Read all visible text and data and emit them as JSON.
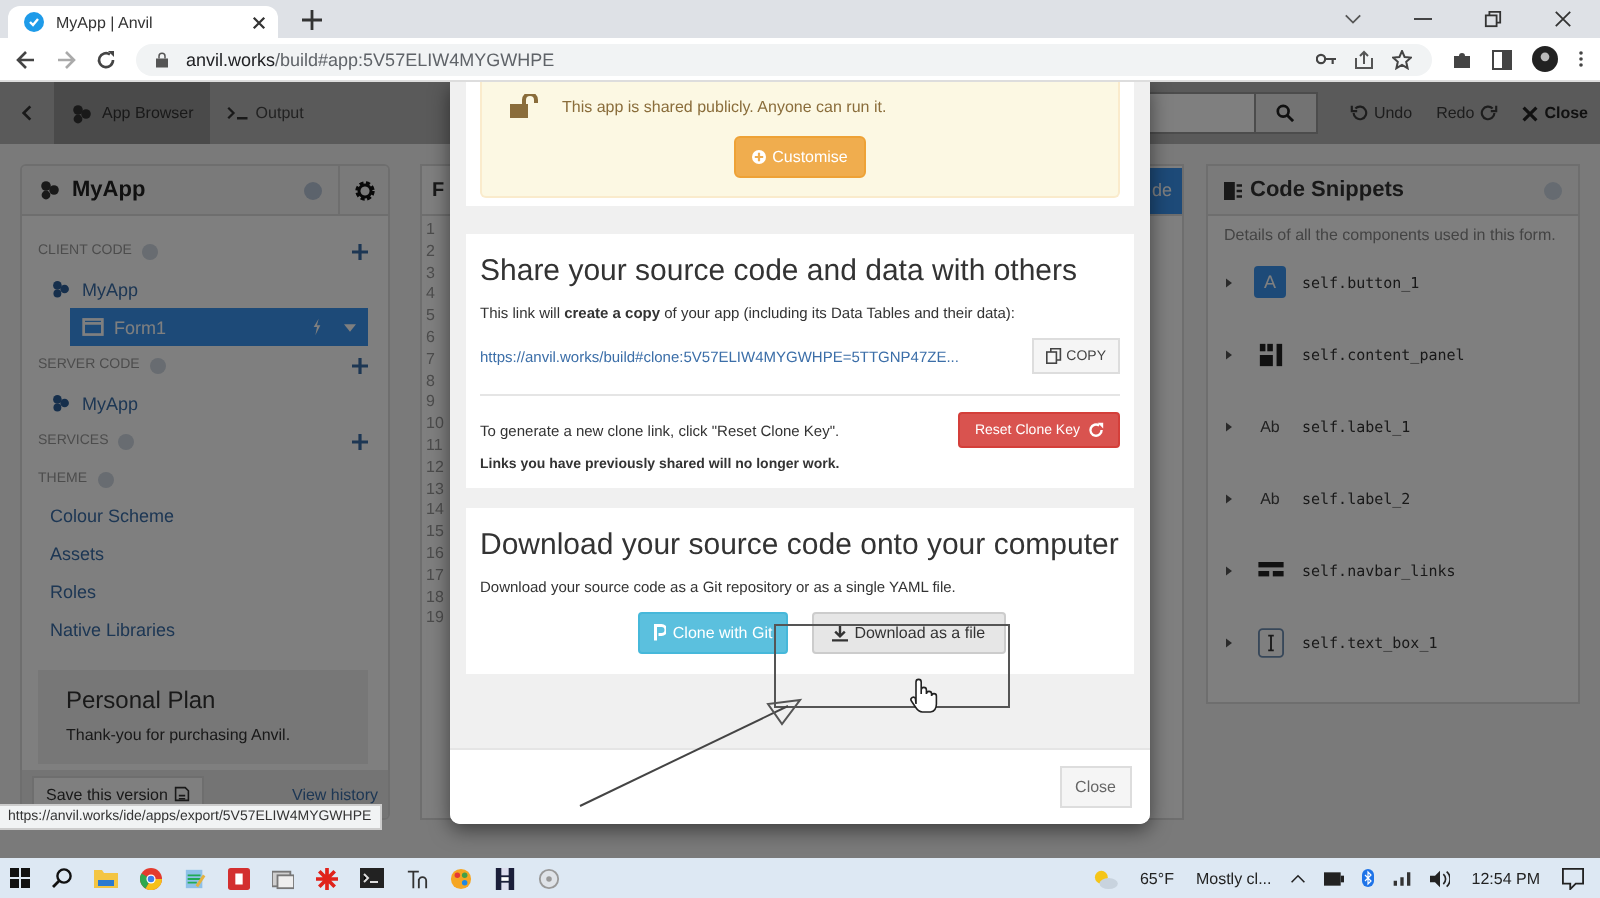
{
  "browser": {
    "tab_title": "MyApp | Anvil",
    "url_host": "anvil.works",
    "url_path": "/build#app:5V57ELIW4MYGWHPE"
  },
  "toolbar": {
    "app_browser": "App Browser",
    "output": "Output",
    "actions": [
      {
        "kind": "undo",
        "label": "Undo",
        "disabled": true
      },
      {
        "kind": "redo",
        "label": "Redo",
        "disabled": true
      },
      {
        "kind": "close",
        "label": "Close",
        "disabled": false
      }
    ]
  },
  "sidebar": {
    "app_name": "MyApp",
    "sections": [
      {
        "kind": "tree",
        "label": "CLIENT CODE",
        "add_button": true,
        "items": [
          {
            "kind": "package",
            "label": "MyApp",
            "selected": false,
            "children": [
              {
                "kind": "form",
                "label": "Form1",
                "selected": true
              }
            ]
          }
        ]
      },
      {
        "kind": "tree",
        "label": "SERVER CODE",
        "add_button": true,
        "items": [
          {
            "kind": "package",
            "label": "MyApp",
            "selected": false
          }
        ]
      },
      {
        "kind": "tree",
        "label": "SERVICES",
        "add_button": true
      },
      {
        "kind": "links",
        "label": "THEME",
        "add_button": false,
        "links": [
          "Colour Scheme",
          "Assets",
          "Roles",
          "Native Libraries"
        ]
      }
    ],
    "plan": {
      "title": "Personal Plan",
      "text": "Thank-you for purchasing Anvil."
    },
    "save_button": "Save this version",
    "history_link": "View history"
  },
  "editor": {
    "title": "F",
    "action": "de",
    "line_numbers": [
      "1",
      "2",
      "3",
      "4",
      "5",
      "6",
      "7",
      "8",
      "9",
      "10",
      "11",
      "12",
      "13",
      "14",
      "15",
      "16",
      "17",
      "18",
      "19"
    ]
  },
  "snippets": {
    "title": "Code Snippets",
    "description": "Details of all the components used in this form.",
    "items": [
      {
        "kind": "button",
        "badge": "A",
        "name": "self.button_1"
      },
      {
        "kind": "panel",
        "name": "self.content_panel"
      },
      {
        "kind": "label",
        "badge": "Ab",
        "name": "self.label_1"
      },
      {
        "kind": "label",
        "badge": "Ab",
        "name": "self.label_2"
      },
      {
        "kind": "navbar",
        "name": "self.navbar_links"
      },
      {
        "kind": "textbox",
        "name": "self.text_box_1"
      }
    ]
  },
  "modal": {
    "banner": {
      "text": "This app is shared publicly. Anyone can run it.",
      "button": "Customise"
    },
    "share": {
      "heading": "Share your source code and data with others",
      "text": "This link will **create a copy** of your app (including its Data Tables and their data):",
      "link": "https://anvil.works/build#clone:5V57ELIW4MYGWHPE=5TTGNP47ZE...",
      "copy_button": "COPY",
      "reset_text": "To generate a new clone link, click \"Reset Clone Key\".",
      "reset_button": "Reset Clone Key",
      "warning": "Links you have previously shared will no longer work."
    },
    "download": {
      "heading": "Download your source code onto your computer",
      "text": "Download your source code as a Git repository or as a single YAML file.",
      "buttons": [
        {
          "kind": "git",
          "label": "Clone with Git"
        },
        {
          "kind": "file",
          "label": "Download as a file"
        }
      ]
    },
    "close_button": "Close"
  },
  "status_url": "https://anvil.works/ide/apps/export/5V57ELIW4MYGWHPE",
  "taskbar": {
    "temperature": "65°F",
    "weather": "Mostly cl...",
    "time": "12:54 PM"
  }
}
